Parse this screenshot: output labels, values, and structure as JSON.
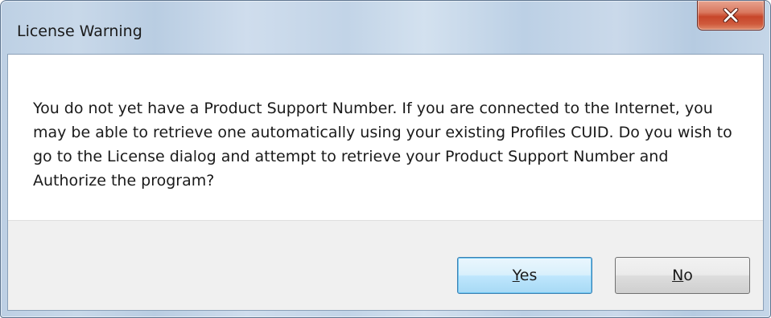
{
  "window": {
    "title": "License Warning",
    "close_label": "X"
  },
  "message": {
    "text": "You do not yet have a Product Support Number.  If you are connected to the Internet, you may be able to retrieve one automatically using your existing Profiles CUID.  Do you wish to go to the License dialog and attempt to retrieve your Product Support Number and Authorize the program?"
  },
  "buttons": {
    "yes": {
      "accel": "Y",
      "rest": "es",
      "is_default": true
    },
    "no": {
      "accel": "N",
      "rest": "o"
    }
  },
  "colors": {
    "close_button": "#c7462a",
    "default_button_border": "#3c7fb1",
    "button_strip": "#f0f0f0"
  },
  "icons": {
    "close": "close-icon"
  }
}
